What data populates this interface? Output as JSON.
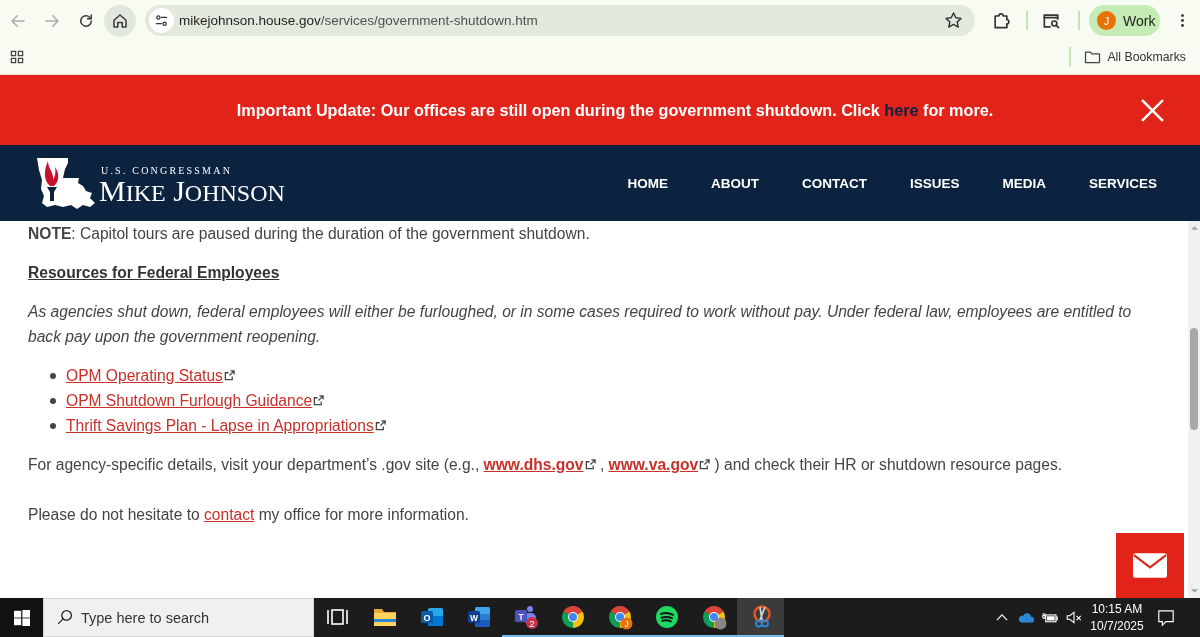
{
  "browser": {
    "toolbar_buttons": [
      {
        "kind": "back",
        "disabled": true,
        "hovered": false
      },
      {
        "kind": "forward",
        "disabled": true,
        "hovered": false
      },
      {
        "kind": "reload",
        "disabled": false,
        "hovered": false
      },
      {
        "kind": "home",
        "disabled": false,
        "hovered": true
      }
    ],
    "address_bar": {
      "host": "mikejohnson.house.gov",
      "path": "/services/government-shutdown.htm",
      "bookmarked": false
    },
    "profile": {
      "initial": "J",
      "name": "Work"
    },
    "bookmarks_bar": {
      "label": "All Bookmarks"
    }
  },
  "alert_banner": {
    "text_before": "Important Update: Our offices are still open during the government shutdown. Click",
    "link": "here",
    "text_after": "for more."
  },
  "site_header": {
    "logo": {
      "subtitle": "U.S. CONGRESSMAN",
      "title": "MIKE JOHNSON"
    },
    "nav": [
      {
        "label": "HOME"
      },
      {
        "label": "ABOUT"
      },
      {
        "label": "CONTACT"
      },
      {
        "label": "ISSUES"
      },
      {
        "label": "MEDIA"
      },
      {
        "label": "SERVICES"
      }
    ]
  },
  "content": {
    "note": "**NOTE**: Capitol tours are paused during the duration of the government shutdown.",
    "heading": "Resources for Federal Employees",
    "intro": "As agencies shut down, federal employees will either be furloughed, or in some cases required to work without pay. Under federal law, employees are entitled to back pay upon the government reopening.",
    "resource_links": [
      {
        "label": "OPM Operating Status",
        "external": true
      },
      {
        "label": "OPM Shutdown Furlough Guidance",
        "external": true
      },
      {
        "label": "Thrift Savings Plan - Lapse in Appropriations",
        "external": true
      }
    ],
    "paragraphs": [
      {
        "parts": [
          {
            "kind": "text",
            "text": "For agency-specific details, visit your department’s .gov site (e.g.,"
          },
          {
            "kind": "link",
            "text": "www.dhs.gov",
            "bold": true,
            "external": true
          },
          {
            "kind": "text",
            "text": ","
          },
          {
            "kind": "link",
            "text": "www.va.gov",
            "bold": true,
            "external": true
          },
          {
            "kind": "text",
            "text": ") and check their HR or shutdown resource pages."
          }
        ]
      },
      {
        "parts": [
          {
            "kind": "text",
            "text": "Please do not hesitate to"
          },
          {
            "kind": "link",
            "text": "contact",
            "bold": false,
            "external": false
          },
          {
            "kind": "text",
            "text": "my office for more information."
          }
        ]
      }
    ]
  },
  "taskbar": {
    "search": {
      "placeholder": "Type here to search"
    },
    "apps": [
      {
        "kind": "task-view",
        "running": false,
        "active": false
      },
      {
        "kind": "files",
        "running": false,
        "active": false
      },
      {
        "kind": "mail",
        "letter": "O",
        "running": false,
        "active": false
      },
      {
        "kind": "document",
        "letter": "W",
        "running": false,
        "active": false
      },
      {
        "kind": "chat",
        "letter": "T",
        "badge": "2",
        "running": true,
        "active": false
      },
      {
        "kind": "browser",
        "running": true,
        "active": false
      },
      {
        "kind": "browser-initial",
        "badge": "J",
        "running": true,
        "active": false
      },
      {
        "kind": "music",
        "running": true,
        "active": false
      },
      {
        "kind": "browser-photo",
        "running": true,
        "active": false
      },
      {
        "kind": "scissors",
        "running": true,
        "active": true
      }
    ],
    "tray": [
      {
        "kind": "chevron"
      },
      {
        "kind": "cloud"
      },
      {
        "kind": "battery"
      },
      {
        "kind": "volume",
        "muted": true
      }
    ],
    "clock": {
      "time": "10:15 AM",
      "date": "10/7/2025"
    }
  }
}
